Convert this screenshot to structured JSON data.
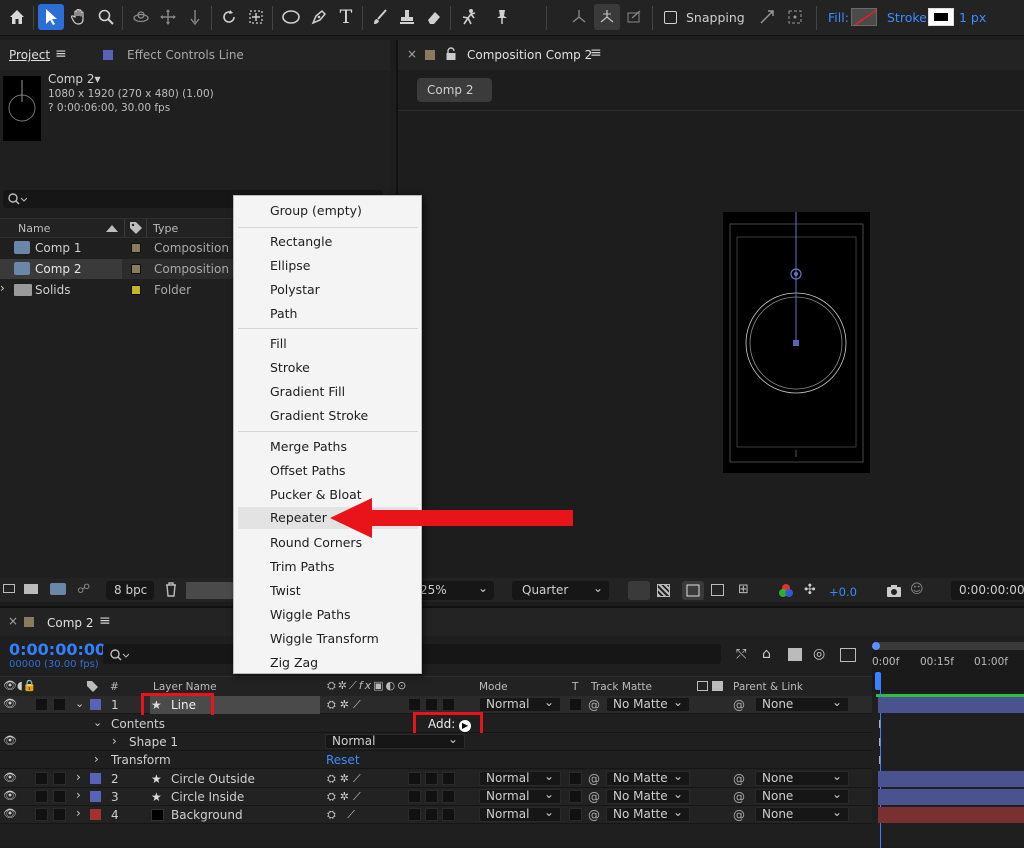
{
  "toolbar": {
    "snapping_label": "Snapping",
    "fill_label": "Fill:",
    "stroke_label": "Stroke:",
    "stroke_width": "1 px"
  },
  "project_panel": {
    "tab_project": "Project",
    "tab_effect_controls": "Effect Controls Line",
    "comp_name": "Comp 2▾",
    "comp_size": "1080 x 1920  (270 x 480) (1.00)",
    "comp_duration": "? 0:00:06:00, 30.00 fps",
    "col_name": "Name",
    "col_type": "Type",
    "items": [
      {
        "name": "Comp 1",
        "type": "Composition",
        "label_color": "#8a7a5e"
      },
      {
        "name": "Comp 2",
        "type": "Composition",
        "label_color": "#8a7a5e"
      },
      {
        "name": "Solids",
        "type": "Folder",
        "label_color": "#c6b32a"
      }
    ],
    "bpc": "8 bpc"
  },
  "composition_panel": {
    "tab_title": "Composition Comp 2",
    "breadcrumb": "Comp 2",
    "zoom": "25%",
    "resolution": "Quarter",
    "exposure": "+0.0",
    "timecode": "0:00:00:00"
  },
  "context_menu": {
    "groups": [
      [
        "Group (empty)"
      ],
      [
        "Rectangle",
        "Ellipse",
        "Polystar",
        "Path"
      ],
      [
        "Fill",
        "Stroke",
        "Gradient Fill",
        "Gradient Stroke"
      ],
      [
        "Merge Paths",
        "Offset Paths",
        "Pucker & Bloat",
        "Repeater",
        "Round Corners",
        "Trim Paths",
        "Twist",
        "Wiggle Paths",
        "Wiggle Transform",
        "Zig Zag"
      ]
    ],
    "highlighted": "Repeater"
  },
  "timeline": {
    "tab": "Comp 2",
    "timecode": "0:00:00:00",
    "frame_info": "00000 (30.00 fps)",
    "col_num": "#",
    "col_layer_name": "Layer Name",
    "col_mode": "Mode",
    "col_t": "T",
    "col_track_matte": "Track Matte",
    "col_parent": "Parent & Link",
    "ruler": [
      "0:00f",
      "00:15f",
      "01:00f"
    ],
    "layer1": {
      "num": "1",
      "name": "Line",
      "mode": "Normal",
      "matte": "No Matte",
      "parent": "None",
      "label_color": "#5a61b8"
    },
    "contents_label": "Contents",
    "add_label": "Add:",
    "shape1_label": "Shape 1",
    "shape1_mode": "Normal",
    "transform_label": "Transform",
    "reset_label": "Reset",
    "layers": [
      {
        "num": "2",
        "name": "Circle Outside",
        "mode": "Normal",
        "matte": "No Matte",
        "parent": "None",
        "label_color": "#5a61b8",
        "bar_color": "#4a5290"
      },
      {
        "num": "3",
        "name": "Circle Inside",
        "mode": "Normal",
        "matte": "No Matte",
        "parent": "None",
        "label_color": "#5a61b8",
        "bar_color": "#4a5290"
      },
      {
        "num": "4",
        "name": "Background",
        "mode": "Normal",
        "matte": "No Matte",
        "parent": "None",
        "label_color": "#a23232",
        "bar_color": "#7a3030"
      }
    ]
  },
  "colors": {
    "accent": "#3d8bff",
    "highlight_red": "#e8141a"
  }
}
